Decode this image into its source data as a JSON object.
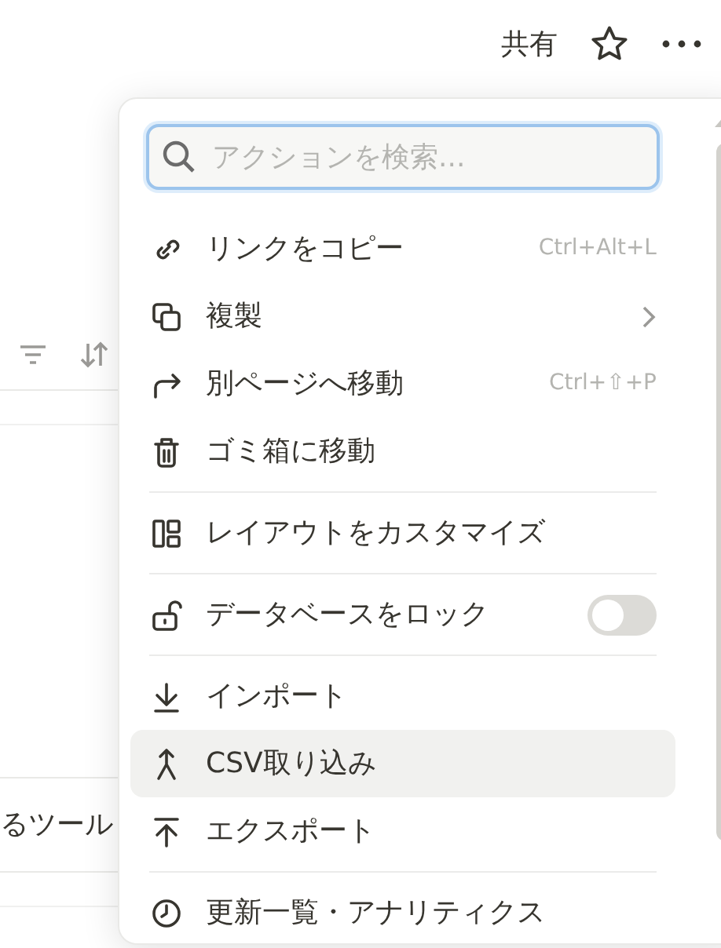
{
  "topbar": {
    "share": "共有"
  },
  "background": {
    "row_text": "るツール"
  },
  "menu": {
    "search": {
      "placeholder": "アクションを検索..."
    },
    "groups": [
      [
        {
          "kind": "action",
          "label": "リンクをコピー",
          "shortcut": "Ctrl+Alt+L",
          "highlighted": false
        },
        {
          "kind": "submenu",
          "label": "複製",
          "highlighted": false
        },
        {
          "kind": "action",
          "label": "別ページへ移動",
          "shortcut": "Ctrl+⇧+P",
          "highlighted": false
        },
        {
          "kind": "action",
          "label": "ゴミ箱に移動",
          "highlighted": false
        }
      ],
      [
        {
          "kind": "action",
          "label": "レイアウトをカスタマイズ",
          "highlighted": false
        }
      ],
      [
        {
          "kind": "toggle",
          "label": "データベースをロック",
          "on": false,
          "highlighted": false
        }
      ],
      [
        {
          "kind": "action",
          "label": "インポート",
          "highlighted": false
        },
        {
          "kind": "action",
          "label": "CSV取り込み",
          "highlighted": true
        },
        {
          "kind": "action",
          "label": "エクスポート",
          "highlighted": false
        }
      ],
      [
        {
          "kind": "action",
          "label": "更新一覧・アナリティクス",
          "highlighted": false
        }
      ]
    ]
  }
}
